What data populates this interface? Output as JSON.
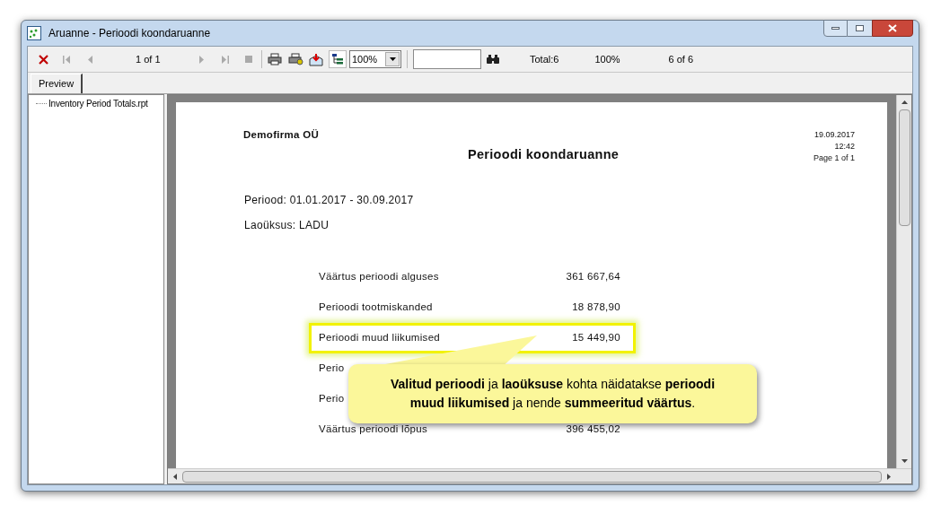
{
  "window": {
    "title": "Aruanne - Perioodi koondaruanne"
  },
  "toolbar": {
    "page_indicator": "1 of 1",
    "zoom": "100%",
    "total": "Total:6",
    "percent": "100%",
    "count": "6 of 6"
  },
  "tabs": [
    {
      "label": "Preview",
      "selected": true
    }
  ],
  "tree": {
    "items": [
      {
        "label": "Inventory Period Totals.rpt"
      }
    ]
  },
  "report": {
    "company": "Demofirma OÜ",
    "title": "Perioodi koondaruanne",
    "date": "19.09.2017",
    "time": "12:42",
    "page": "Page 1 of 1",
    "period": "Periood: 01.01.2017 - 30.09.2017",
    "warehouse": "Laoüksus: LADU",
    "rows": [
      {
        "label": "Väärtus perioodi alguses",
        "value": "361 667,64",
        "highlighted": false
      },
      {
        "label": "Perioodi tootmiskanded",
        "value": "18 878,90",
        "highlighted": false
      },
      {
        "label": "Perioodi muud liikumised",
        "value": "15 449,90",
        "highlighted": true
      },
      {
        "label": "Perio",
        "highlighted": false
      },
      {
        "label": "Perio",
        "highlighted": false
      },
      {
        "label": "Väärtus perioodi lõpus",
        "value": "396 455,02",
        "highlighted": false
      }
    ]
  },
  "callout": {
    "text": "**Valitud perioodi** ja **laoüksuse** kohta näidatakse **perioodi muud liikumised** ja nende **summeeritud väärtus**."
  }
}
